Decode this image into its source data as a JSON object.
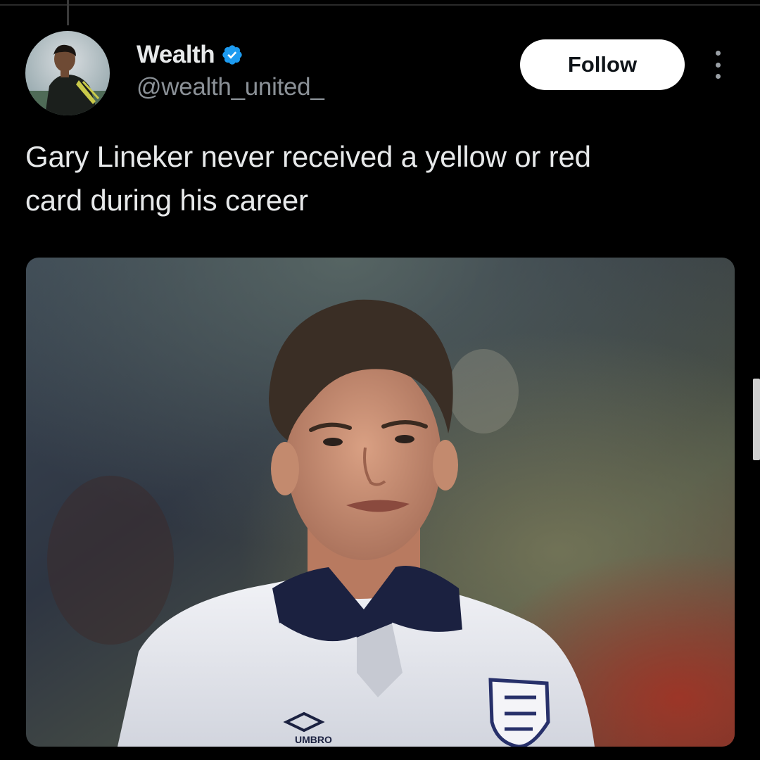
{
  "author": {
    "name": "Wealth",
    "handle": "@wealth_united_",
    "verified": true
  },
  "follow_label": "Follow",
  "tweet": {
    "line1": "Gary Lineker never received a yellow or red",
    "line2": "card during his career"
  },
  "media": {
    "kit_logo_text": "UMBRO"
  },
  "colors": {
    "background": "#000000",
    "text": "#e7e9ea",
    "muted": "#8b9197",
    "verified": "#1d9bf0",
    "button_bg": "#ffffff",
    "button_text": "#0f1419"
  },
  "icons": [
    "verified-badge-icon",
    "more-options-icon"
  ]
}
